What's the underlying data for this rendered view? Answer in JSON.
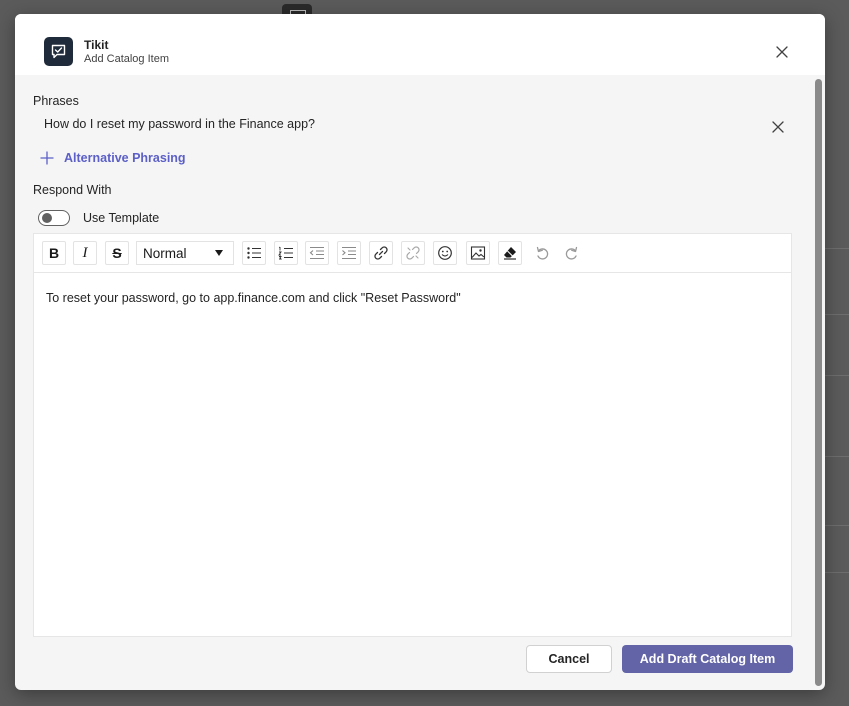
{
  "app": {
    "name": "Tikit",
    "subtitle": "Add Catalog Item",
    "icon": "chat-check-icon"
  },
  "phrases": {
    "label": "Phrases",
    "items": [
      "How do I reset my password in the Finance app?"
    ],
    "add_label": "Alternative Phrasing"
  },
  "respond": {
    "label": "Respond With",
    "template_toggle_label": "Use Template",
    "template_enabled": false
  },
  "editor": {
    "format_value": "Normal",
    "toolbar_icons": [
      "bold-icon",
      "italic-icon",
      "strikethrough-icon",
      "bulleted-list-icon",
      "numbered-list-icon",
      "outdent-icon",
      "indent-icon",
      "link-icon",
      "unlink-icon",
      "emoji-icon",
      "image-icon",
      "clear-format-icon",
      "undo-icon",
      "redo-icon"
    ],
    "content": "To reset your password, go to app.finance.com and click \"Reset Password\""
  },
  "footer": {
    "cancel_label": "Cancel",
    "submit_label": "Add Draft Catalog Item"
  },
  "colors": {
    "accent": "#6264a7",
    "link": "#5b5fc7",
    "app_icon_bg": "#1f2b3a"
  }
}
